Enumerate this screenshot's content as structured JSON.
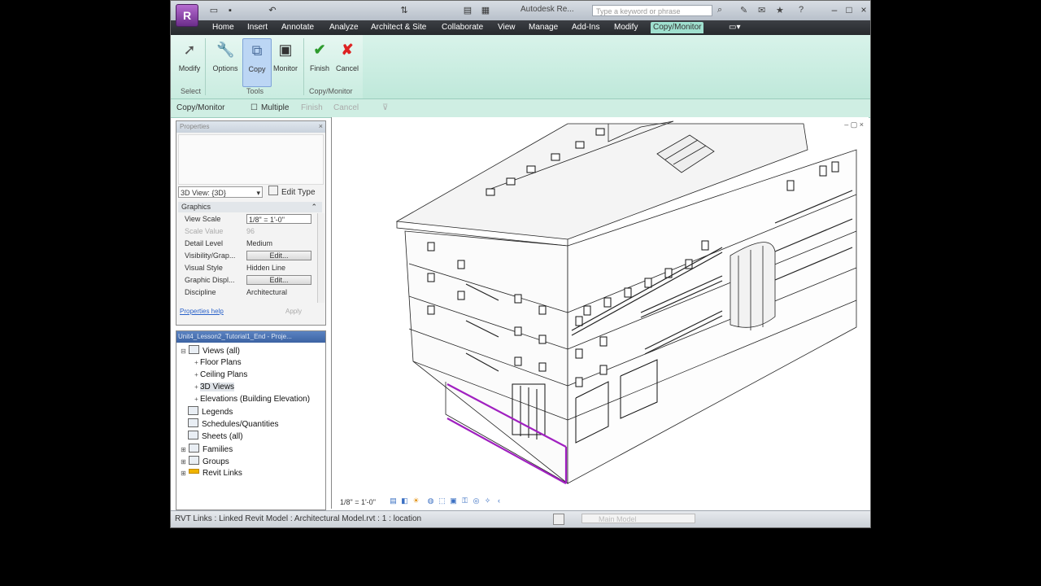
{
  "app": {
    "logo_letter": "R",
    "title_text": "Autodesk Re...",
    "search_placeholder": "Type a keyword or phrase"
  },
  "tabs": [
    {
      "label": "Home"
    },
    {
      "label": "Insert"
    },
    {
      "label": "Annotate"
    },
    {
      "label": "Analyze"
    },
    {
      "label": "Architect & Site"
    },
    {
      "label": "Collaborate"
    },
    {
      "label": "View"
    },
    {
      "label": "Manage"
    },
    {
      "label": "Add-Ins"
    },
    {
      "label": "Modify"
    },
    {
      "label": "Copy/Monitor"
    }
  ],
  "ribbon": {
    "buttons": [
      {
        "label": "Modify",
        "icon": "cursor-arrow-icon"
      },
      {
        "label": "Options",
        "icon": "wrench-icon"
      },
      {
        "label": "Copy",
        "icon": "copy-icon"
      },
      {
        "label": "Monitor",
        "icon": "monitor-icon"
      },
      {
        "label": "Finish",
        "icon": "checkmark-icon"
      },
      {
        "label": "Cancel",
        "icon": "cancel-x-icon"
      }
    ],
    "panels": [
      {
        "label": "Select"
      },
      {
        "label": "Tools"
      },
      {
        "label": "Copy/Monitor"
      }
    ]
  },
  "options_bar": {
    "context_label": "Copy/Monitor",
    "multiple_label": "Multiple",
    "finish_label": "Finish",
    "cancel_label": "Cancel"
  },
  "properties": {
    "title": "Properties",
    "type_selector": "3D View: {3D}",
    "edit_type_label": "Edit Type",
    "group_label": "Graphics",
    "rows": [
      {
        "label": "View Scale",
        "value": "1/8\" = 1'-0\""
      },
      {
        "label": "Scale Value",
        "value": "96"
      },
      {
        "label": "Detail Level",
        "value": "Medium"
      },
      {
        "label": "Visibility/Grap...",
        "value": "Edit..."
      },
      {
        "label": "Visual Style",
        "value": "Hidden Line"
      },
      {
        "label": "Graphic Displ...",
        "value": "Edit..."
      },
      {
        "label": "Discipline",
        "value": "Architectural"
      }
    ],
    "help_link": "Properties help",
    "apply_label": "Apply"
  },
  "project_browser": {
    "title": "Unit4_Lesson2_Tutorial1_End - Proje...",
    "nodes": [
      {
        "label": "Views (all)"
      },
      {
        "label": "Floor Plans"
      },
      {
        "label": "Ceiling Plans"
      },
      {
        "label": "3D Views"
      },
      {
        "label": "Elevations (Building Elevation)"
      },
      {
        "label": "Legends"
      },
      {
        "label": "Schedules/Quantities"
      },
      {
        "label": "Sheets (all)"
      },
      {
        "label": "Families"
      },
      {
        "label": "Groups"
      },
      {
        "label": "Revit Links"
      }
    ]
  },
  "view": {
    "scale_text": "1/8\" = 1'-0\""
  },
  "status": {
    "text": "RVT Links : Linked Revit Model : Architectural Model.rvt : 1 : location",
    "main_model": "Main Model"
  },
  "colors": {
    "ribbon_bg": "#c9ece0",
    "active_tab": "#9fe0cf",
    "selection_highlight": "#a020c0",
    "browser_title_bg": "#3c63a3"
  }
}
